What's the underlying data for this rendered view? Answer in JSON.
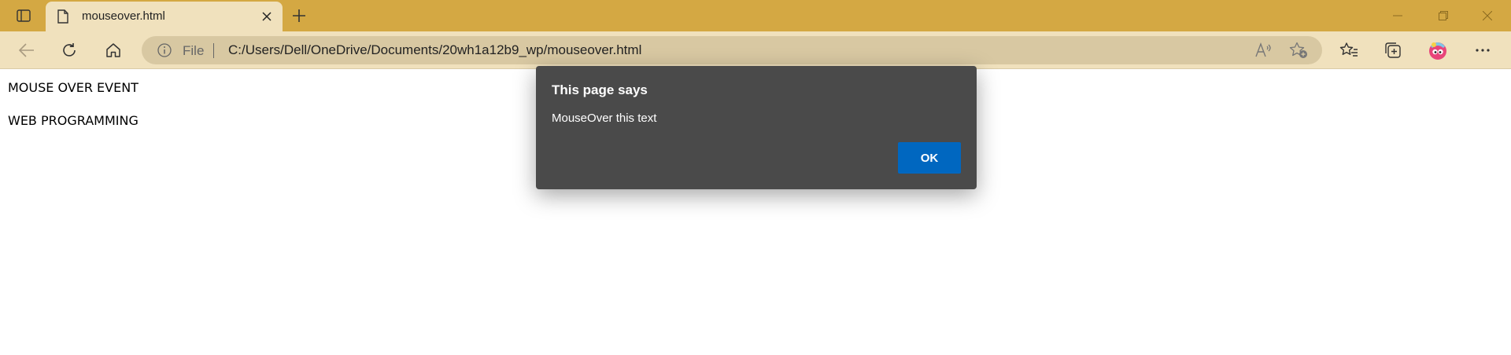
{
  "browser": {
    "tab": {
      "title": "mouseover.html"
    },
    "address": {
      "scheme_label": "File",
      "url": "C:/Users/Dell/OneDrive/Documents/20wh1a12b9_wp/mouseover.html"
    },
    "icons": [
      "tab-actions-icon",
      "page-icon",
      "close-icon",
      "plus-icon",
      "minimize-icon",
      "restore-icon",
      "window-close-icon",
      "back-arrow-icon",
      "refresh-icon",
      "home-icon",
      "info-icon",
      "read-aloud-icon",
      "add-favorite-icon",
      "favorites-icon",
      "collections-icon",
      "profile-avatar-icon",
      "more-icon"
    ],
    "colors": {
      "tabstrip": "#d4a843",
      "toolbar": "#f0e1bd",
      "addressbar": "#d8c8a2"
    }
  },
  "page": {
    "lines": [
      "MOUSE OVER EVENT",
      "WEB PROGRAMMING"
    ]
  },
  "dialog": {
    "title": "This page says",
    "message": "MouseOver this text",
    "ok_label": "OK",
    "colors": {
      "background": "#4a4a4a",
      "button": "#0067c0"
    }
  }
}
